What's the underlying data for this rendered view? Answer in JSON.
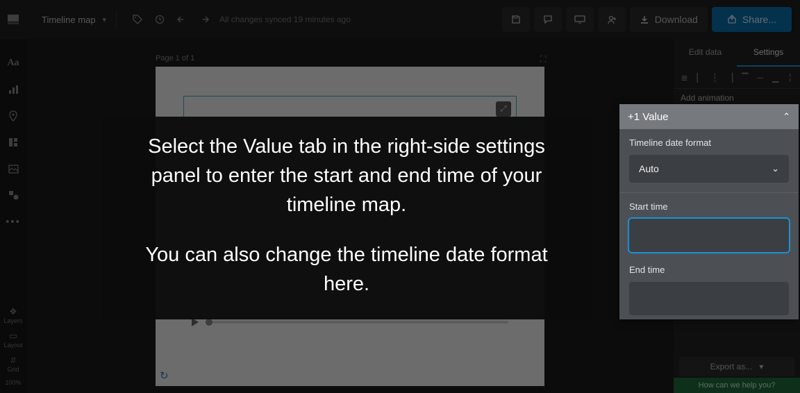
{
  "topbar": {
    "title": "Timeline map",
    "status": "All changes synced 19 minutes ago",
    "download": "Download",
    "share": "Share..."
  },
  "leftrail": {
    "layers": "Layers",
    "layout": "Layout",
    "grid": "Grid",
    "zoom": "100%"
  },
  "canvas": {
    "page_label": "Page 1 of 1"
  },
  "rightpanel": {
    "tab_edit": "Edit data",
    "tab_settings": "Settings",
    "add_animation": "Add animation",
    "export": "Export as...",
    "help": "How can we help you?"
  },
  "tip": {
    "p1": "Select the Value tab in the right-side settings panel to enter the start and end time of your timeline map.",
    "p2": "You can also change the timeline date format here."
  },
  "popover": {
    "header": "+1 Value",
    "date_format_label": "Timeline date format",
    "date_format_value": "Auto",
    "start_label": "Start time",
    "start_value": "",
    "end_label": "End time",
    "end_value": ""
  }
}
